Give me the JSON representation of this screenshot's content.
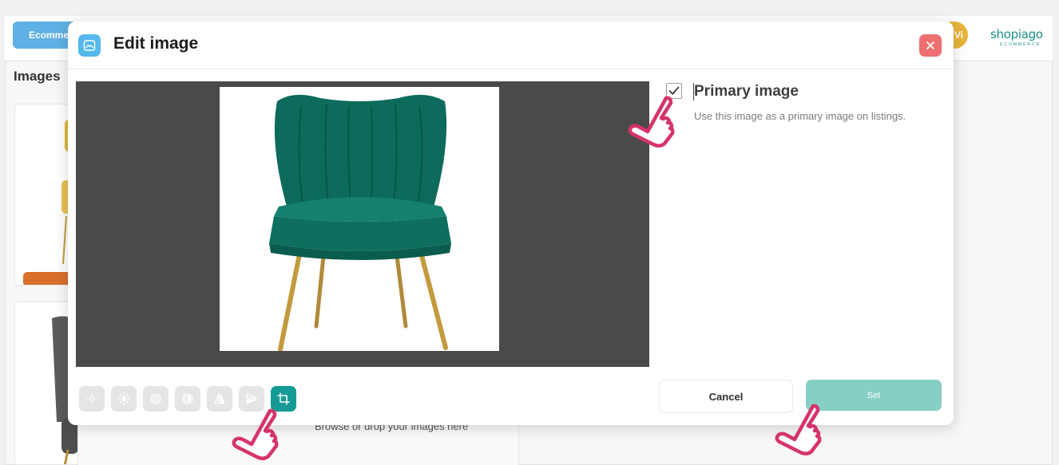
{
  "app": {
    "tab_label": "Ecommerce",
    "avatar_initials": "Vi",
    "brand_name": "shopiago",
    "brand_tagline": "ECOMMERCE",
    "images_heading": "Images",
    "upload_text": "Browse or drop your images here"
  },
  "modal": {
    "title": "Edit image",
    "icon": "image-icon",
    "close_icon": "close-icon",
    "primary_label": "Primary image",
    "primary_description": "Use this image as a primary image on listings.",
    "primary_checked": true,
    "cancel_label": "Cancel",
    "set_label": "Set",
    "image_subject": "green-velvet-chair",
    "tools": [
      {
        "name": "brightness-low-icon",
        "active": false
      },
      {
        "name": "brightness-high-icon",
        "active": false
      },
      {
        "name": "contrast-icon",
        "active": false
      },
      {
        "name": "saturation-icon",
        "active": false
      },
      {
        "name": "flip-horizontal-icon",
        "active": false
      },
      {
        "name": "flip-vertical-icon",
        "active": false
      },
      {
        "name": "crop-icon",
        "active": true
      }
    ]
  },
  "colors": {
    "accent_teal": "#159a95",
    "set_button": "#86cfc4",
    "close_button": "#ee6f6f",
    "modal_icon": "#55b8ec",
    "canvas_bg": "#4a4a4a",
    "cursor_outline": "#d6336c",
    "tab_pill": "#5fb0e4",
    "avatar": "#e8b53a"
  },
  "annotations": [
    {
      "name": "pointer-cursor-icon",
      "target": "primary-image-checkbox"
    },
    {
      "name": "pointer-cursor-icon",
      "target": "crop-tool-button"
    },
    {
      "name": "pointer-cursor-icon",
      "target": "set-button"
    }
  ]
}
